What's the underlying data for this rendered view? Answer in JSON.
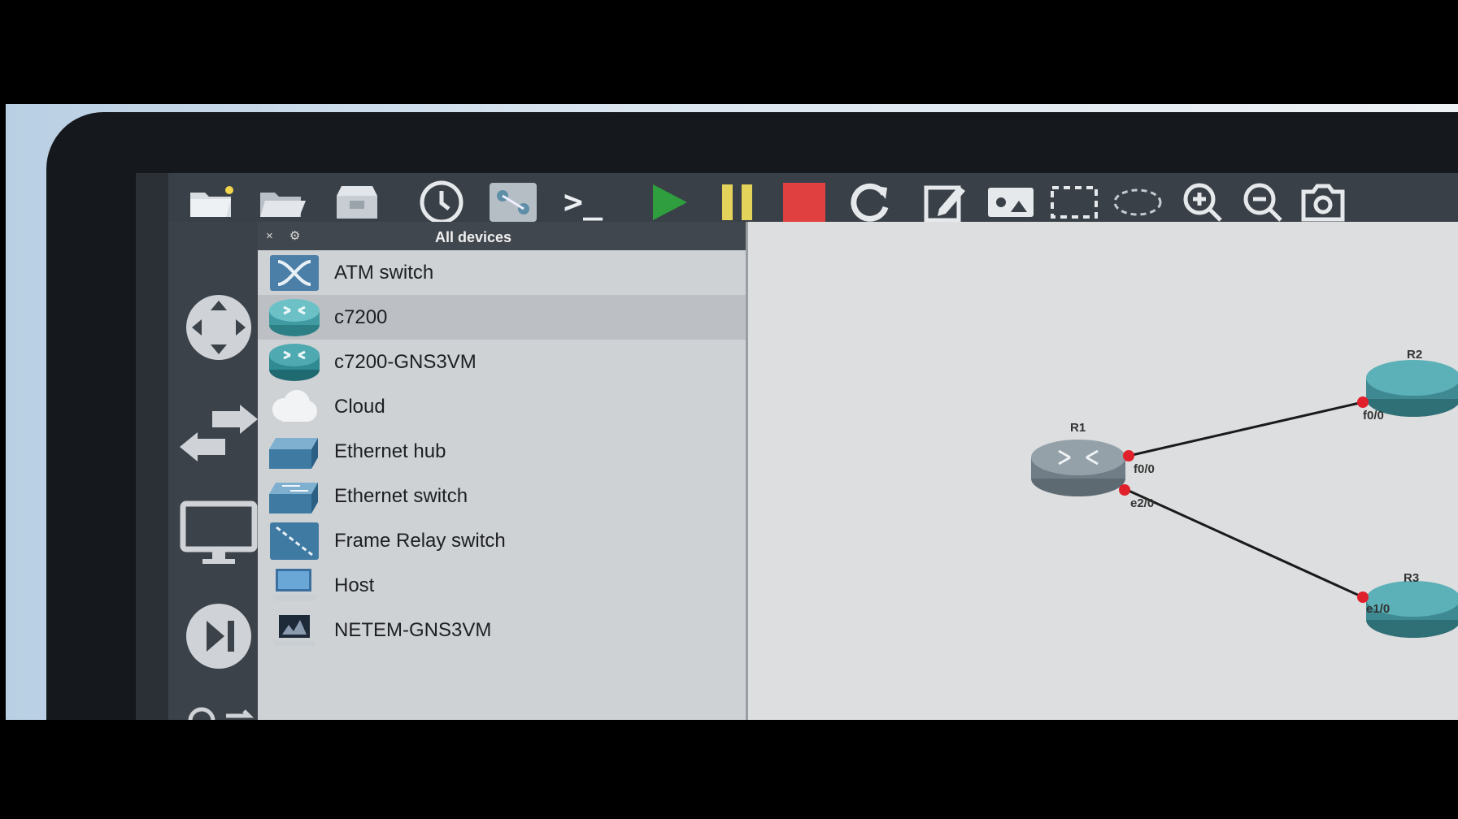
{
  "toolbar": {
    "items": [
      {
        "icon": "new-project-icon"
      },
      {
        "icon": "open-project-icon"
      },
      {
        "icon": "save-project-icon"
      },
      {
        "icon": "snapshot-clock-icon"
      },
      {
        "icon": "topology-summary-icon"
      },
      {
        "icon": "console-icon",
        "glyph": ">_"
      },
      {
        "icon": "start-all-icon"
      },
      {
        "icon": "suspend-all-icon"
      },
      {
        "icon": "stop-all-icon"
      },
      {
        "icon": "reload-all-icon"
      },
      {
        "icon": "add-note-icon"
      },
      {
        "icon": "insert-image-icon"
      },
      {
        "icon": "draw-rectangle-icon"
      },
      {
        "icon": "draw-ellipse-icon"
      },
      {
        "icon": "zoom-in-icon"
      },
      {
        "icon": "zoom-out-icon"
      },
      {
        "icon": "screenshot-icon"
      }
    ],
    "colors": {
      "start": "#2e9e3e",
      "suspend": "#e4d35a",
      "stop": "#e04040"
    }
  },
  "rail": {
    "items": [
      {
        "icon": "routers-icon"
      },
      {
        "icon": "switches-icon"
      },
      {
        "icon": "end-devices-icon"
      },
      {
        "icon": "security-devices-icon"
      },
      {
        "icon": "all-devices-icon"
      }
    ]
  },
  "panel": {
    "title": "All devices",
    "controls": "× ⚙",
    "devices": [
      {
        "label": "ATM switch",
        "icon": "atm-switch-icon"
      },
      {
        "label": "c7200",
        "icon": "router-icon",
        "selected": true
      },
      {
        "label": "c7200-GNS3VM",
        "icon": "router-icon"
      },
      {
        "label": "Cloud",
        "icon": "cloud-icon"
      },
      {
        "label": "Ethernet hub",
        "icon": "ethernet-hub-icon"
      },
      {
        "label": "Ethernet switch",
        "icon": "ethernet-switch-icon"
      },
      {
        "label": "Frame Relay switch",
        "icon": "frame-relay-switch-icon"
      },
      {
        "label": "Host",
        "icon": "host-icon"
      },
      {
        "label": "NETEM-GNS3VM",
        "icon": "netem-icon"
      }
    ]
  },
  "topology": {
    "nodes": [
      {
        "name": "R1"
      },
      {
        "name": "R2"
      },
      {
        "name": "R3"
      }
    ],
    "ports": {
      "r1_top": "f0/0",
      "r1_bottom": "e2/0",
      "r2": "f0/0",
      "r3": "e1/0"
    }
  }
}
